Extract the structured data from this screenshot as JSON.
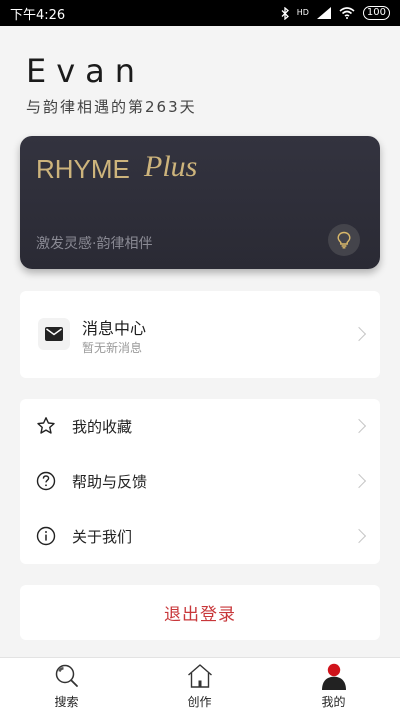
{
  "status_bar": {
    "time": "下午4:26",
    "network": "HD",
    "battery": "100"
  },
  "user": {
    "name": "Evan",
    "days_text": "与韵律相遇的第263天"
  },
  "plus_card": {
    "brand": "RHYME",
    "plus": "Plus",
    "slogan": "激发灵感·韵律相伴"
  },
  "messages": {
    "title": "消息中心",
    "subtitle": "暂无新消息"
  },
  "menu": {
    "items": [
      {
        "label": "我的收藏"
      },
      {
        "label": "帮助与反馈"
      },
      {
        "label": "关于我们"
      }
    ]
  },
  "logout": {
    "label": "退出登录"
  },
  "tabbar": {
    "tabs": [
      {
        "label": "搜索"
      },
      {
        "label": "创作"
      },
      {
        "label": "我的"
      }
    ]
  },
  "colors": {
    "card": "#2e2e38",
    "gold": "#cdb47c",
    "logout": "#c8373a",
    "tab_active": "#d0131b"
  }
}
